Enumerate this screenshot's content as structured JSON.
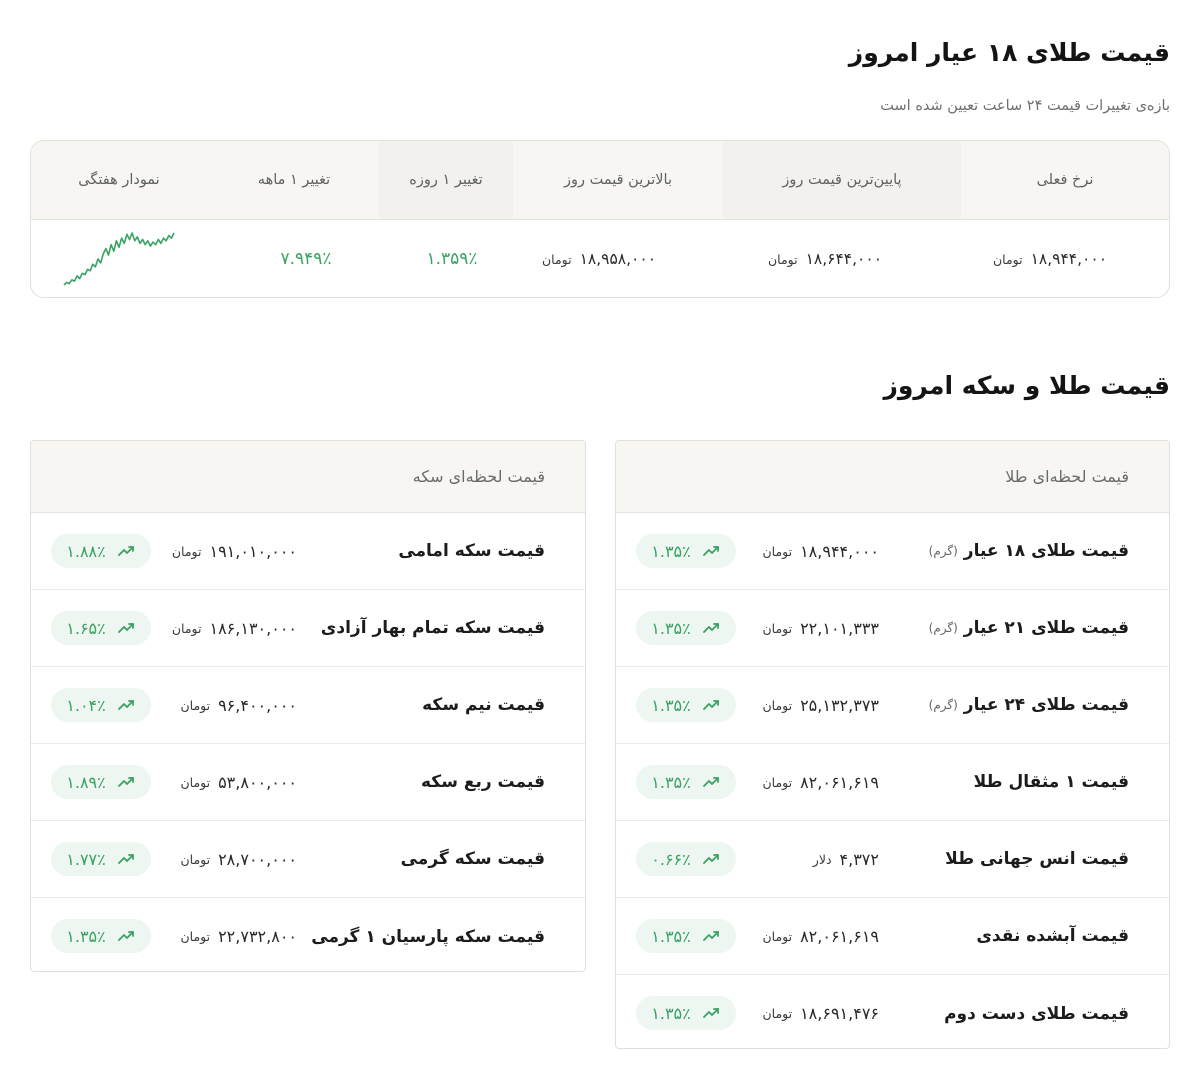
{
  "section1": {
    "title": "قیمت طلای ۱۸ عیار امروز",
    "subtitle": "بازه‌ی تغییرات قیمت ۲۴ ساعت تعیین شده است",
    "table": {
      "headers": {
        "current": "نرخ فعلی",
        "lowest": "پایین‌ترین قیمت روز",
        "highest": "بالاترین قیمت روز",
        "day_change": "تغییر ۱ روزه",
        "month_change": "تغییر ۱ ماهه",
        "weekly_chart": "نمودار هفتگی"
      },
      "row": {
        "current": "۱۸,۹۴۴,۰۰۰",
        "lowest": "۱۸,۶۴۴,۰۰۰",
        "highest": "۱۸,۹۵۸,۰۰۰",
        "day_change": "۱.۳۵۹٪",
        "month_change": "۷.۹۴۹٪",
        "unit": "تومان"
      },
      "sparkline": [
        10,
        12,
        11,
        14,
        13,
        17,
        15,
        19,
        18,
        22,
        21,
        26,
        24,
        30,
        27,
        34,
        38,
        33,
        41,
        36,
        44,
        39,
        46,
        42,
        49,
        45,
        50,
        44,
        47,
        42,
        45,
        41,
        44,
        40,
        43,
        41,
        45,
        42,
        46,
        44,
        48,
        46,
        50
      ]
    }
  },
  "section2": {
    "title": "قیمت طلا و سکه امروز",
    "gold_panel": {
      "title": "قیمت لحظه‌ای طلا",
      "rows": [
        {
          "name": "قیمت طلای ۱۸ عیار",
          "gram": "(گرم)",
          "price": "۱۸,۹۴۴,۰۰۰",
          "unit": "تومان",
          "change": "۱.۳۵٪"
        },
        {
          "name": "قیمت طلای ۲۱ عیار",
          "gram": "(گرم)",
          "price": "۲۲,۱۰۱,۳۳۳",
          "unit": "تومان",
          "change": "۱.۳۵٪"
        },
        {
          "name": "قیمت طلای ۲۴ عیار",
          "gram": "(گرم)",
          "price": "۲۵,۱۳۲,۳۷۳",
          "unit": "تومان",
          "change": "۱.۳۵٪"
        },
        {
          "name": "قیمت ۱ مثقال طلا",
          "gram": "",
          "price": "۸۲,۰۶۱,۶۱۹",
          "unit": "تومان",
          "change": "۱.۳۵٪"
        },
        {
          "name": "قیمت انس جهانی طلا",
          "gram": "",
          "price": "۴,۳۷۲",
          "unit": "دلار",
          "change": "۰.۶۶٪"
        },
        {
          "name": "قیمت آبشده نقدی",
          "gram": "",
          "price": "۸۲,۰۶۱,۶۱۹",
          "unit": "تومان",
          "change": "۱.۳۵٪"
        },
        {
          "name": "قیمت طلای دست دوم",
          "gram": "",
          "price": "۱۸,۶۹۱,۴۷۶",
          "unit": "تومان",
          "change": "۱.۳۵٪"
        }
      ]
    },
    "coin_panel": {
      "title": "قیمت لحظه‌ای سکه",
      "rows": [
        {
          "name": "قیمت سکه امامی",
          "price": "۱۹۱,۰۱۰,۰۰۰",
          "unit": "تومان",
          "change": "۱.۸۸٪"
        },
        {
          "name": "قیمت سکه تمام بهار آزادی",
          "price": "۱۸۶,۱۳۰,۰۰۰",
          "unit": "تومان",
          "change": "۱.۶۵٪"
        },
        {
          "name": "قیمت نیم سکه",
          "price": "۹۶,۴۰۰,۰۰۰",
          "unit": "تومان",
          "change": "۱.۰۴٪"
        },
        {
          "name": "قیمت ربع سکه",
          "price": "۵۳,۸۰۰,۰۰۰",
          "unit": "تومان",
          "change": "۱.۸۹٪"
        },
        {
          "name": "قیمت سکه گرمی",
          "price": "۲۸,۷۰۰,۰۰۰",
          "unit": "تومان",
          "change": "۱.۷۷٪"
        },
        {
          "name": "قیمت سکه پارسیان ۱ گرمی",
          "price": "۲۲,۷۳۲,۸۰۰",
          "unit": "تومان",
          "change": "۱.۳۵٪"
        }
      ]
    }
  },
  "colors": {
    "positive": "#3aa262",
    "badge_bg": "#edf6f0",
    "header_bg": "#f7f6f3",
    "border": "#e3e0db"
  },
  "icons": {
    "trend": "trending-up-icon"
  }
}
